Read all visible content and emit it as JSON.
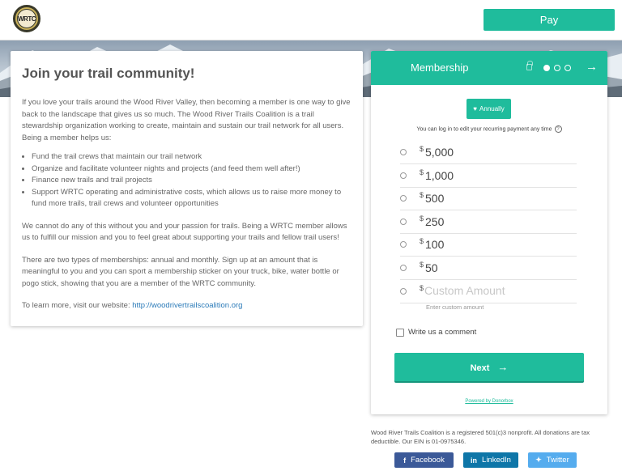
{
  "header": {
    "logo_text": "WRTC",
    "pay_label": "Pay"
  },
  "info": {
    "title": "Join your trail community!",
    "intro": "If you love your trails around the Wood River Valley, then becoming a member is one way to give back to the landscape that gives us so much. The Wood River Trails Coalition is a trail stewardship organization working to create, maintain and sustain our trail network for all users. Being a member helps us:",
    "bullets": [
      "Fund the trail crews that maintain our trail network",
      "Organize and facilitate volunteer nights and projects (and feed them well after!)",
      "Finance new trails and trail projects",
      "Support WRTC operating and administrative costs, which allows us to raise more money to fund more trails, trail crews and volunteer opportunities"
    ],
    "para2": "We cannot do any of this without you and your passion for trails. Being a WRTC member allows us to fulfill our mission and you to feel great about supporting your trails and fellow trail users!",
    "para3": "There are two types of memberships: annual and monthly. Sign up at an amount that is meaningful to you and you can sport a membership sticker on your truck, bike, water bottle or pogo stick, showing that you are a member of the WRTC community.",
    "learn_more": "To learn more, visit our website:",
    "link": "http://woodrivertrailscoalition.org"
  },
  "donation": {
    "title": "Membership",
    "frequency_label": "Annually",
    "login_note": "You can log in to edit your recurring payment any time",
    "currency_symbol": "$",
    "amounts": [
      "5,000",
      "1,000",
      "500",
      "250",
      "100",
      "50"
    ],
    "custom_placeholder": "Custom Amount",
    "custom_hint": "Enter custom amount",
    "comment_label": "Write us a comment",
    "next_label": "Next",
    "powered_by": "Powered by Donorbox"
  },
  "footer": {
    "note": "Wood River Trails Coalition is a registered 501(c)3 nonprofit. All donations are tax deductible. Our EIN is 01-0975346.",
    "share": {
      "facebook": "Facebook",
      "linkedin": "LinkedIn",
      "twitter": "Twitter"
    }
  },
  "colors": {
    "accent": "#1fbc9c",
    "facebook": "#3b5998",
    "linkedin": "#0e76a8",
    "twitter": "#55acee"
  }
}
